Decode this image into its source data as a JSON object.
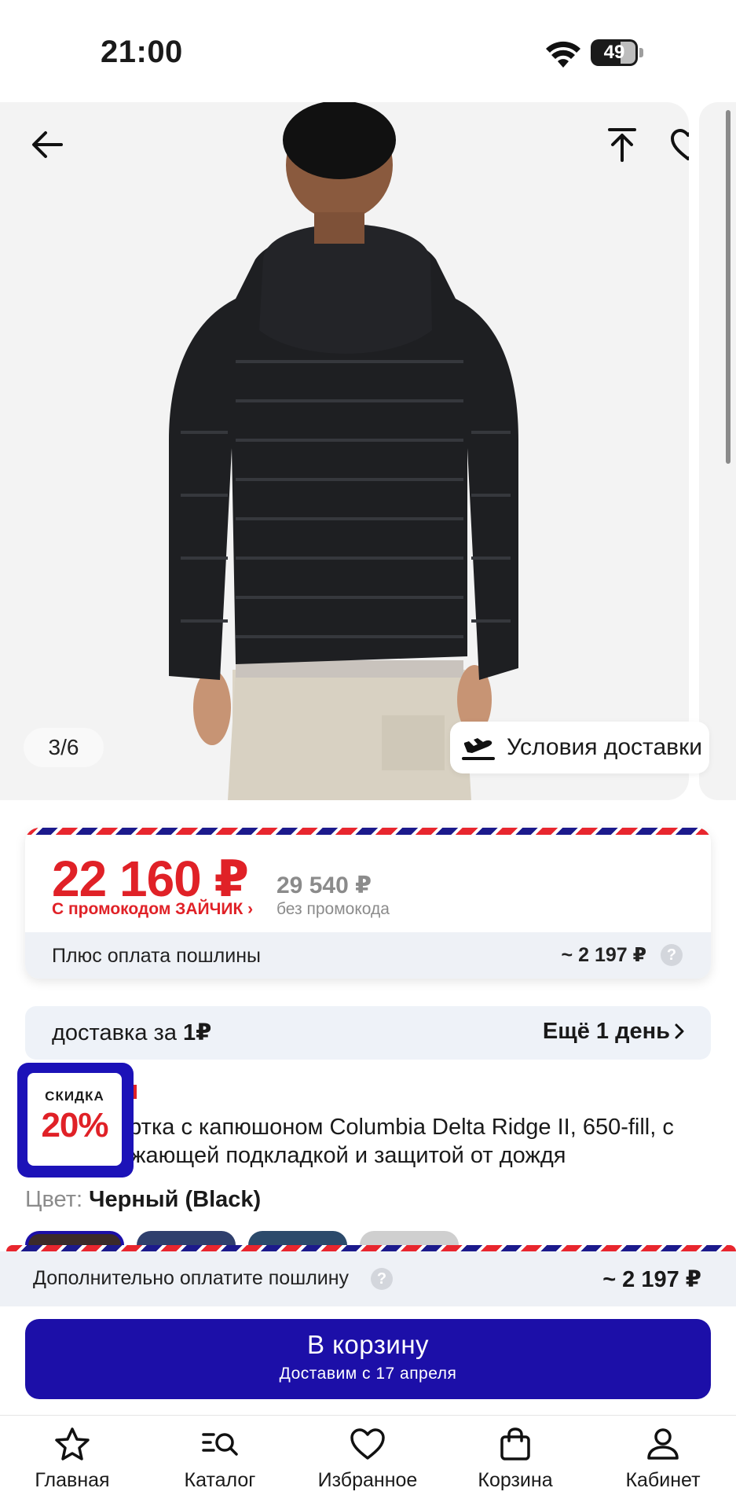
{
  "status_bar": {
    "time": "21:00",
    "battery": "49"
  },
  "gallery": {
    "counter": "3/6",
    "delivery_chip": "Условия доставки"
  },
  "price": {
    "current": "22 160 ₽",
    "promo": "С промокодом ЗАЙЧИК ›",
    "old": "29 540 ₽",
    "old_label": "без промокода",
    "duty_label": "Плюс оплата пошлины",
    "duty_value": "~ 2 197 ₽"
  },
  "delivery": {
    "left_text": "доставка за ",
    "left_amount": "1₽",
    "right_text": "Ещё 1 день"
  },
  "sale_badge": {
    "label": "СКИДКА",
    "value": "20%"
  },
  "product": {
    "title": "уртка с капюшоном Columbia Delta Ridge II, 650-fill, с ажающей подкладкой и защитой от дождя",
    "color_label": "Цвет: ",
    "color_value": "Черный (Black)"
  },
  "bottom_sheet": {
    "duty_label": "Дополнительно оплатите пошлину",
    "duty_value": "~ 2 197 ₽",
    "cart_title": "В корзину",
    "cart_sub": "Доставим с 17 апреля"
  },
  "nav": [
    {
      "label": "Главная",
      "icon": "star-icon"
    },
    {
      "label": "Каталог",
      "icon": "catalog-search-icon"
    },
    {
      "label": "Избранное",
      "icon": "heart-icon"
    },
    {
      "label": "Корзина",
      "icon": "bag-icon"
    },
    {
      "label": "Кабинет",
      "icon": "user-icon"
    }
  ],
  "colors": {
    "price_red": "#e02127",
    "brand_blue": "#1c0fa8"
  }
}
